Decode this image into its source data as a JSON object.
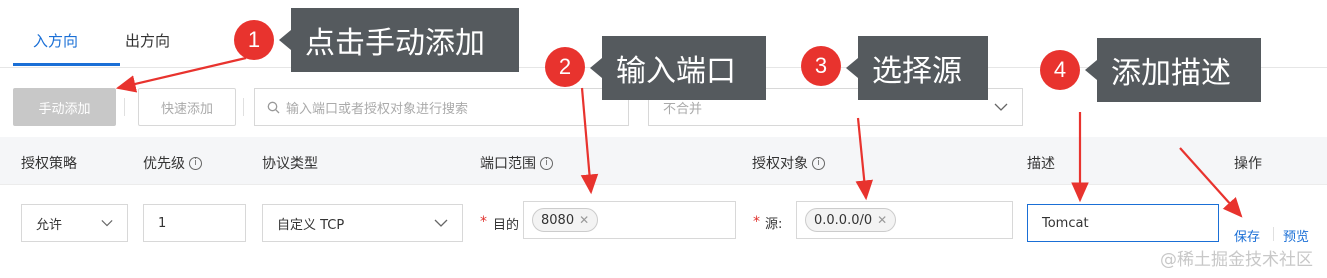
{
  "tabs": [
    {
      "label": "入方向"
    },
    {
      "label": "出方向"
    }
  ],
  "toolbar": {
    "manual_add": "手动添加",
    "quick_add": "快速添加",
    "search_placeholder": "输入端口或者授权对象进行搜索",
    "merge_select": "不合并"
  },
  "table": {
    "headers": [
      "授权策略",
      "优先级",
      "协议类型",
      "端口范围",
      "授权对象",
      "描述",
      "操作"
    ]
  },
  "row": {
    "policy": "允许",
    "priority": "1",
    "protocol": "自定义 TCP",
    "port_label": "目的",
    "port_tag": "8080",
    "source_label": "源:",
    "source_tag": "0.0.0.0/0",
    "description": "Tomcat",
    "save": "保存",
    "preview": "预览"
  },
  "annotations": [
    {
      "number": "1",
      "text": "点击手动添加"
    },
    {
      "number": "2",
      "text": "输入端口"
    },
    {
      "number": "3",
      "text": "选择源"
    },
    {
      "number": "4",
      "text": "添加描述"
    }
  ],
  "watermark": "@稀土掘金技术社区",
  "colors": {
    "accent": "#1a6fd6",
    "annotation_red": "#e8332e",
    "callout_bg": "#555a5e"
  }
}
